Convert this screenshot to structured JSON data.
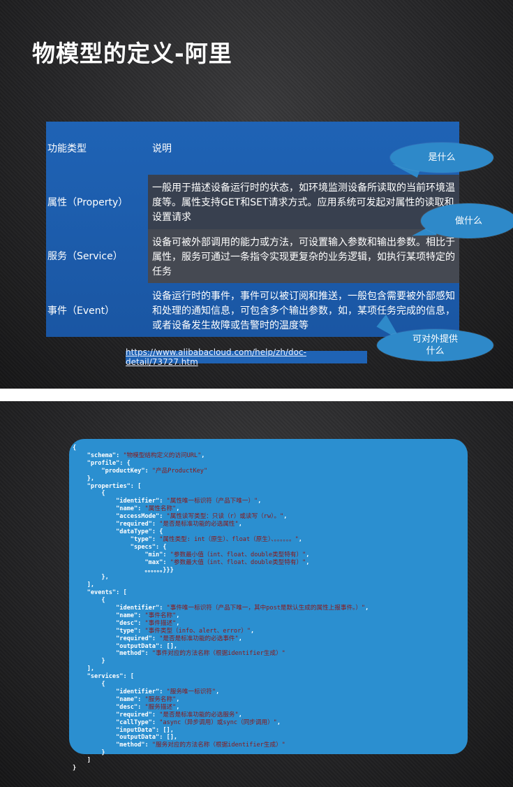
{
  "slide1": {
    "title": "物模型的定义-阿里",
    "table": {
      "header": {
        "col1": "功能类型",
        "col2": "说明"
      },
      "rows": [
        {
          "type": "属性（Property）",
          "desc": "一般用于描述设备运行时的状态，如环境监测设备所读取的当前环境温度等。属性支持GET和SET请求方式。应用系统可发起对属性的读取和设置请求"
        },
        {
          "type": "服务（Service）",
          "desc": "设备可被外部调用的能力或方法，可设置输入参数和输出参数。相比于属性，服务可通过一条指令实现更复杂的业务逻辑，如执行某项特定的任务"
        },
        {
          "type": "事件（Event）",
          "desc": "设备运行时的事件，事件可以被订阅和推送，一般包含需要被外部感知和处理的通知信息，可包含多个输出参数，如，某项任务完成的信息，或者设备发生故障或告警时的温度等"
        }
      ]
    },
    "bubbles": {
      "what": "是什么",
      "doWhat": "做什么",
      "provide": "可对外提供什么"
    },
    "link": "https://www.alibabacloud.com/help/zh/doc-detail/73727.htm",
    "colors": {
      "table_blue": "#1f63b5",
      "bubble_blue": "#2e89c9"
    }
  },
  "slide2": {
    "code": {
      "schema_key": "\"schema\"",
      "schema_val": "\"物模型结构定义的访问URL\"",
      "profile_key": "\"profile\"",
      "productKey_key": "\"productKey\"",
      "productKey_val": "\"产品ProductKey\"",
      "properties_key": "\"properties\"",
      "p_identifier_val": "\"属性唯一标识符（产品下唯一）\"",
      "p_name_val": "\"属性名称\"",
      "p_access_val": "\"属性读写类型：只读（r）或读写（rw）。\"",
      "p_required_val": "\"是否是标准功能的必选属性\"",
      "p_dt_type_val": "\"属性类型: int（原生）、float（原生）、。。。。。。\"",
      "p_min_val": "\"参数最小值（int、float、double类型特有）\"",
      "p_max_val": "\"参数最大值（int、float、double类型特有）\"",
      "p_ellipsis": "。。。。。。}}}",
      "events_key": "\"events\"",
      "e_identifier_val": "\"事件唯一标识符（产品下唯一，其中post是默认生成的属性上报事件。）\"",
      "e_name_val": "\"事件名称\"",
      "e_desc_val": "\"事件描述\"",
      "e_type_val": "\"事件类型（info、alert、error）\"",
      "e_required_val": "\"是否是标准功能的必选事件\"",
      "e_method_val": "\"事件对应的方法名称（根据identifier生成）\"",
      "services_key": "\"services\"",
      "s_identifier_val": "\"服务唯一标识符\"",
      "s_name_val": "\"服务名称\"",
      "s_desc_val": "\"服务描述\"",
      "s_required_val": "\"是否是标准功能的必选服务\"",
      "s_calltype_val": "\"async（异步调用）或sync（同步调用）\"",
      "s_method_val": "\"服务对应的方法名称（根据identifier生成）\"",
      "k_identifier": "\"identifier\"",
      "k_name": "\"name\"",
      "k_access": "\"accessMode\"",
      "k_required": "\"required\"",
      "k_datatype": "\"dataType\"",
      "k_type": "\"type\"",
      "k_specs": "\"specs\"",
      "k_min": "\"min\"",
      "k_max": "\"max\"",
      "k_desc": "\"desc\"",
      "k_output": "\"outputData\"",
      "k_method": "\"method\"",
      "k_calltype": "\"callType\"",
      "k_input": "\"inputData\""
    },
    "colors": {
      "panel": "#2b8fd0",
      "value_text": "#8b1717"
    }
  }
}
